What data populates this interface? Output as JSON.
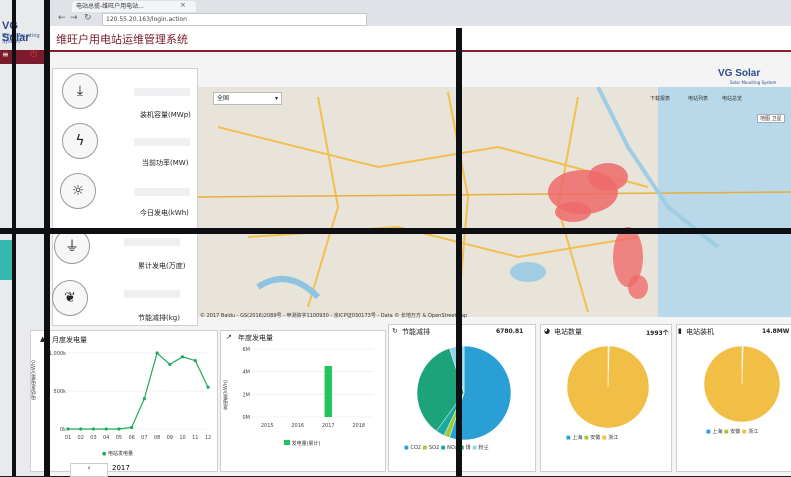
{
  "left_window": {
    "brand": "VG Solar",
    "brand_sub": "Solar Mounting System"
  },
  "browser": {
    "tab_title": "电站总揽-维旺户用电站...",
    "url": "120.55.20.163/login.action"
  },
  "app": {
    "title": "维旺户用电站运维管理系统",
    "logo": "VG Solar",
    "logo_sub": "Solar Mounting System"
  },
  "metrics": [
    {
      "label": "装机容量(MWp)",
      "icon": "download-icon"
    },
    {
      "label": "当前功率(MW)",
      "icon": "lightning-icon"
    },
    {
      "label": "今日发电(kWh)",
      "icon": "sun-icon"
    },
    {
      "label": "累计发电(万度)",
      "icon": "plug-icon"
    },
    {
      "label": "节能减排(kg)",
      "icon": "leaf-icon"
    }
  ],
  "map": {
    "region_select": "全国",
    "toolbar": [
      "下载报表",
      "电站列表",
      "电站总览"
    ],
    "map_types": [
      "地图",
      "卫星"
    ],
    "copyright": "© 2017 Baidu - GS(2016)2089号 - 甲测资字1100930 - 京ICP证030173号 - Data © 长地万方 & OpenStreetMap"
  },
  "panels": {
    "monthly": {
      "title": "月度发电量",
      "ylabel": "电站发电量(kWh)",
      "footer_year": "2017",
      "legend": "电站发电量"
    },
    "yearly": {
      "title": "年度发电量",
      "ylabel": "发电量(kWh)",
      "legend": "发电量(累计)"
    },
    "energy": {
      "title": "节能减排",
      "value": "6780.81",
      "legend": [
        "CO2",
        "SO2",
        "NOx",
        "煤",
        "粉尘"
      ]
    },
    "station_count": {
      "title": "电站数量",
      "value": "1993个",
      "legend": [
        "上海",
        "安徽",
        "浙江"
      ]
    },
    "station_capacity": {
      "title": "电站装机",
      "value": "14.8MW",
      "legend": [
        "上海",
        "安徽",
        "浙江"
      ]
    }
  },
  "chart_data": [
    {
      "type": "line",
      "title": "月度发电量",
      "ylabel": "电站发电量(kWh)",
      "categories": [
        "01",
        "02",
        "03",
        "04",
        "05",
        "06",
        "07",
        "08",
        "09",
        "10",
        "11",
        "12"
      ],
      "values": [
        0,
        0,
        0,
        0,
        0,
        20000,
        400000,
        1000000,
        850000,
        950000,
        900000,
        550000
      ],
      "yticks": [
        "0k",
        "500k",
        "1,000k"
      ],
      "ylim": [
        0,
        1000000
      ]
    },
    {
      "type": "bar",
      "title": "年度发电量",
      "ylabel": "发电量(kWh)",
      "categories": [
        "2015",
        "2016",
        "2017",
        "2018"
      ],
      "values": [
        0,
        0,
        4500000,
        0
      ],
      "yticks": [
        "0M",
        "2M",
        "4M",
        "6M"
      ],
      "ylim": [
        0,
        6000000
      ]
    },
    {
      "type": "pie",
      "title": "节能减排",
      "labels": [
        "CO2",
        "SO2",
        "NOx",
        "煤",
        "粉尘"
      ],
      "values": [
        55,
        2,
        3,
        35,
        5
      ],
      "colors": [
        "#2a9fd6",
        "#9ec93a",
        "#19a9a0",
        "#1da37a",
        "#8fd6e8"
      ]
    },
    {
      "type": "pie",
      "title": "电站数量",
      "labels": [
        "上海",
        "安徽",
        "浙江"
      ],
      "values": [
        0.3,
        0.2,
        99.5
      ],
      "colors": [
        "#2a9fd6",
        "#9ec93a",
        "#f1bf45"
      ]
    },
    {
      "type": "pie",
      "title": "电站装机",
      "labels": [
        "上海",
        "安徽",
        "浙江"
      ],
      "values": [
        0.3,
        0.2,
        99.5
      ],
      "colors": [
        "#2a9fd6",
        "#9ec93a",
        "#f1bf45"
      ]
    }
  ]
}
